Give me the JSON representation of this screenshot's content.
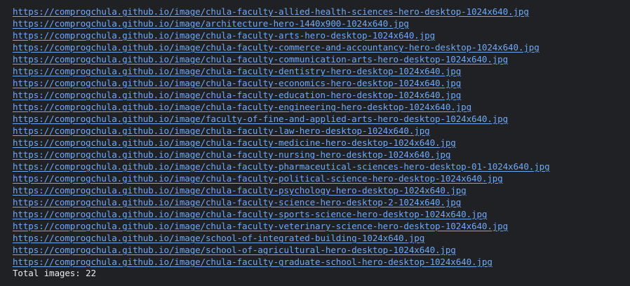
{
  "console": {
    "links": [
      "https://comprogchula.github.io/image/chula-faculty-allied-health-sciences-hero-desktop-1024x640.jpg",
      "https://comprogchula.github.io/image/architecture-hero-1440x900-1024x640.jpg",
      "https://comprogchula.github.io/image/chula-faculty-arts-hero-desktop-1024x640.jpg",
      "https://comprogchula.github.io/image/chula-faculty-commerce-and-accountancy-hero-desktop-1024x640.jpg",
      "https://comprogchula.github.io/image/chula-faculty-communication-arts-hero-desktop-1024x640.jpg",
      "https://comprogchula.github.io/image/chula-faculty-dentistry-hero-desktop-1024x640.jpg",
      "https://comprogchula.github.io/image/chula-faculty-economics-hero-desktop-1024x640.jpg",
      "https://comprogchula.github.io/image/chula-faculty-education-hero-desktop-1024x640.jpg",
      "https://comprogchula.github.io/image/chula-faculty-engineering-hero-desktop-1024x640.jpg",
      "https://comprogchula.github.io/image/faculty-of-fine-and-applied-arts-hero-desktop-1024x640.jpg",
      "https://comprogchula.github.io/image/chula-faculty-law-hero-desktop-1024x640.jpg",
      "https://comprogchula.github.io/image/chula-faculty-medicine-hero-desktop-1024x640.jpg",
      "https://comprogchula.github.io/image/chula-faculty-nursing-hero-desktop-1024x640.jpg",
      "https://comprogchula.github.io/image/chula-faculty-pharmaceutical-sciences-hero-desktop-01-1024x640.jpg",
      "https://comprogchula.github.io/image/chula-faculty-political-science-hero-desktop-1024x640.jpg",
      "https://comprogchula.github.io/image/chula-faculty-psychology-hero-desktop-1024x640.jpg",
      "https://comprogchula.github.io/image/chula-faculty-science-hero-desktop-2-1024x640.jpg",
      "https://comprogchula.github.io/image/chula-faculty-sports-science-hero-desktop-1024x640.jpg",
      "https://comprogchula.github.io/image/chula-faculty-veterinary-science-hero-desktop-1024x640.jpg",
      "https://comprogchula.github.io/image/school-of-integrated-building-1024x640.jpg",
      "https://comprogchula.github.io/image/school-of-agricultural-hero-desktop-1024x640.jpg",
      "https://comprogchula.github.io/image/chula-faculty-graduate-school-hero-desktop-1024x640.jpg"
    ],
    "summary": "Total images: 22"
  },
  "colors": {
    "background": "#202124",
    "link": "#6ea8f7",
    "text": "#e8eaed"
  }
}
